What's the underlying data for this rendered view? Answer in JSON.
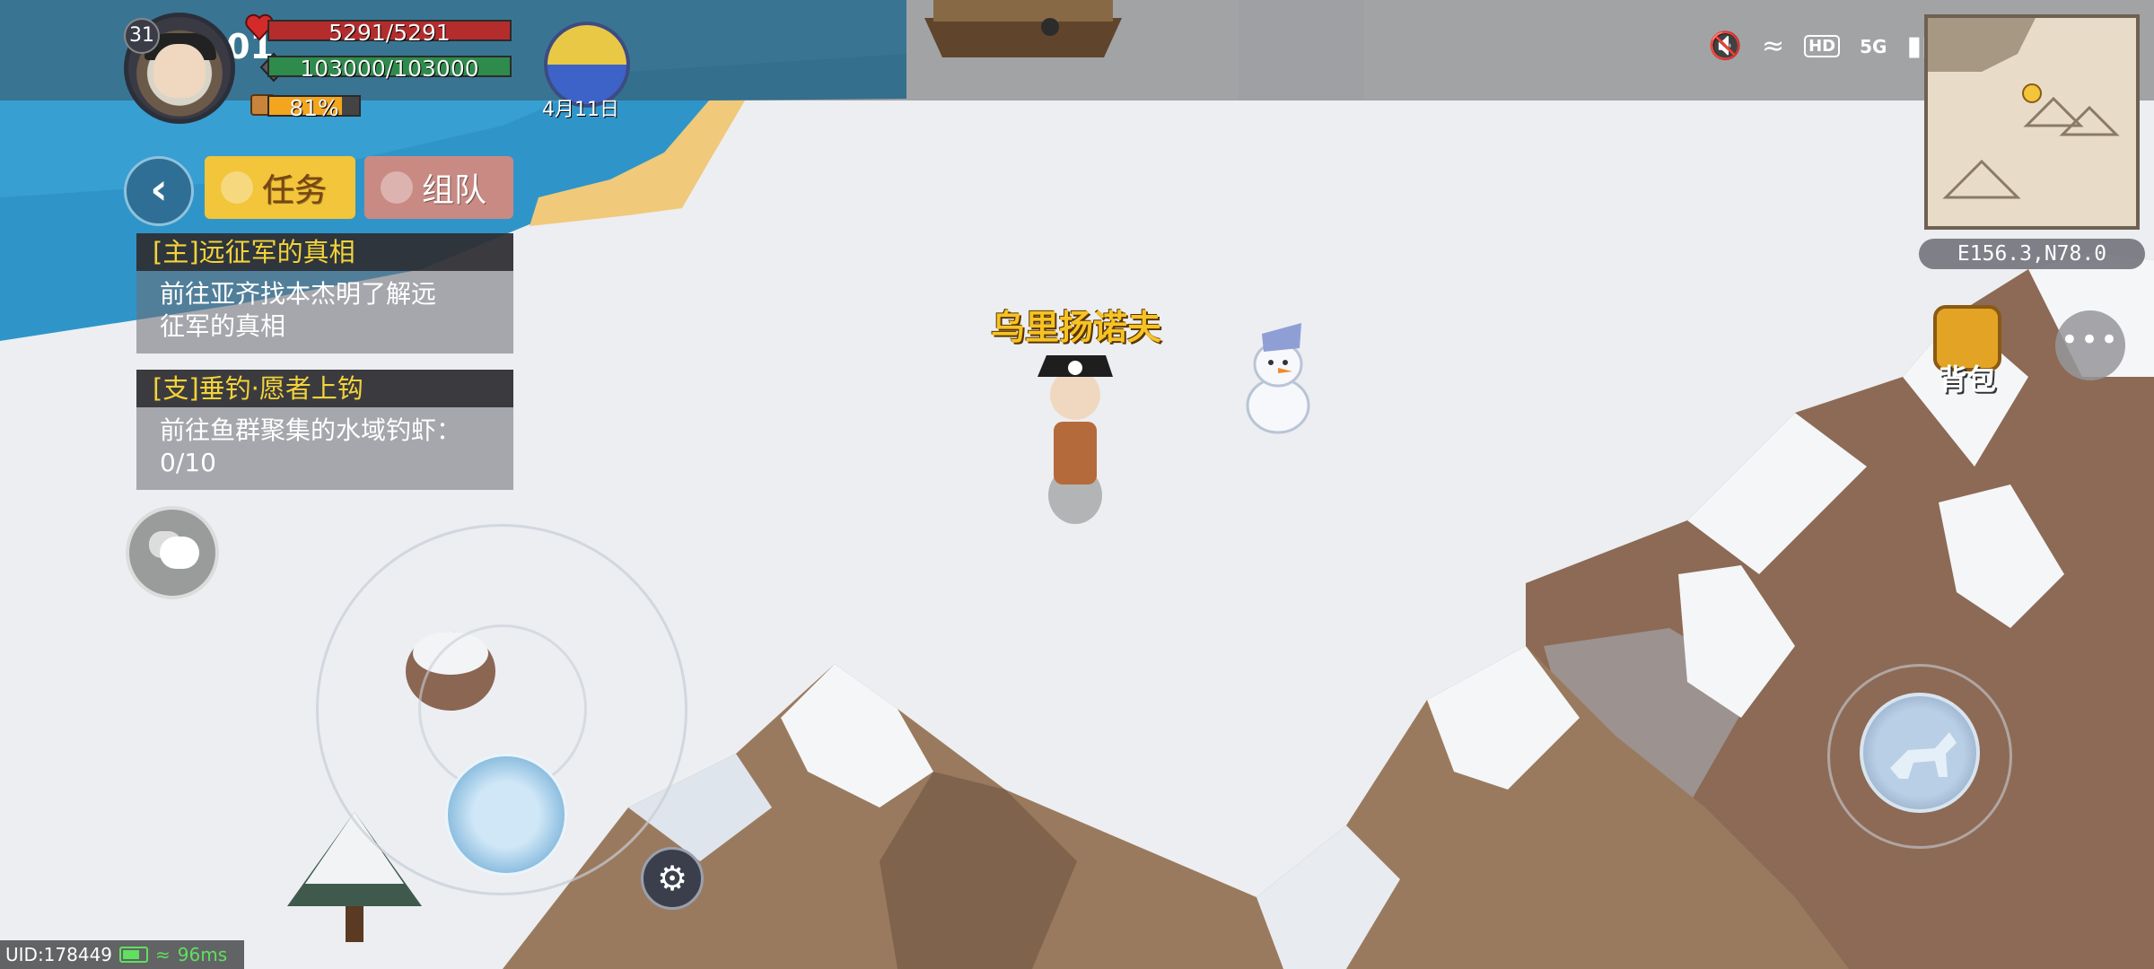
{
  "status_bar": {
    "time": "21:01",
    "network": "5G",
    "hd_label": "HD"
  },
  "player": {
    "level": "31",
    "hp_text": "5291/5291",
    "energy_text": "103000/103000",
    "exp_text": "81%",
    "exp_fraction": 0.81
  },
  "calendar": {
    "date": "4月11日"
  },
  "tabs": {
    "quest_label": "任务",
    "team_label": "组队"
  },
  "quests": [
    {
      "title": "[主]远征军的真相",
      "desc": "前往亚齐找本杰明了解远征军的真相"
    },
    {
      "title": "[支]垂钓·愿者上钩",
      "desc": "前往鱼群聚集的水域钓虾：0/10"
    }
  ],
  "npc": {
    "name": "乌里扬诺夫"
  },
  "minimap": {
    "coords": "E156.3,N78.0"
  },
  "buttons": {
    "bag_label": "背包",
    "more_label": "•••"
  },
  "footer": {
    "uid": "UID:178449",
    "ping": "96ms"
  },
  "colors": {
    "hp": "#b42c2c",
    "energy": "#2e8b4c",
    "exp": "#f3a51e",
    "quest_title": "#f4d33a",
    "npc_name": "#f6c325"
  },
  "icons": [
    "heart-icon",
    "energy-icon",
    "exp-box-icon",
    "back-arrow-icon",
    "quest-icon",
    "team-icon",
    "chat-icon",
    "skill-icon",
    "mount-horse-icon",
    "bag-icon",
    "more-icon",
    "wifi-icon",
    "signal-icon",
    "mute-icon",
    "battery-icon"
  ]
}
